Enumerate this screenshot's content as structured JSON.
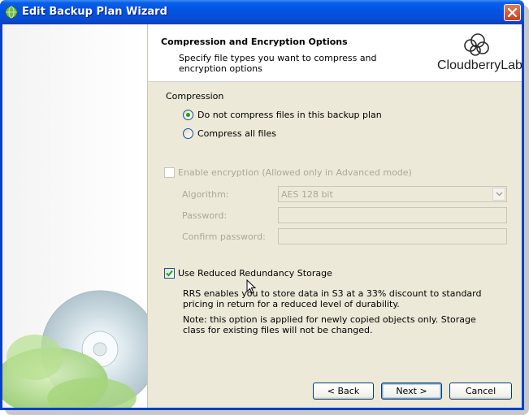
{
  "window": {
    "title": "Edit Backup Plan Wizard"
  },
  "header": {
    "title": "Compression and Encryption Options",
    "subtitle": "Specify file types you want to compress and encryption options",
    "logo_text": "CloudberryLab"
  },
  "compression": {
    "group_label": "Compression",
    "options": [
      {
        "label": "Do not compress files in this backup plan",
        "selected": true
      },
      {
        "label": "Compress all files",
        "selected": false
      }
    ]
  },
  "encryption": {
    "enable_label": "Enable encryption (Allowed only in Advanced mode)",
    "enabled": false,
    "algorithm_label": "Algorithm:",
    "algorithm_value": "AES 128 bit",
    "password_label": "Password:",
    "confirm_label": "Confirm password:"
  },
  "rrs": {
    "checkbox_label": "Use Reduced Redundancy Storage",
    "checked": true,
    "description_1": "RRS enables you to store data in S3 at a 33% discount to standard pricing in return for a reduced level of durability.",
    "description_2": "Note: this option is applied for newly copied objects only. Storage class for existing files will not be changed."
  },
  "buttons": {
    "back": "< Back",
    "next": "Next >",
    "cancel": "Cancel"
  },
  "colors": {
    "titlebar": "#0054e3",
    "dialog_bg": "#ece9d8",
    "radio_dot": "#21a121"
  }
}
